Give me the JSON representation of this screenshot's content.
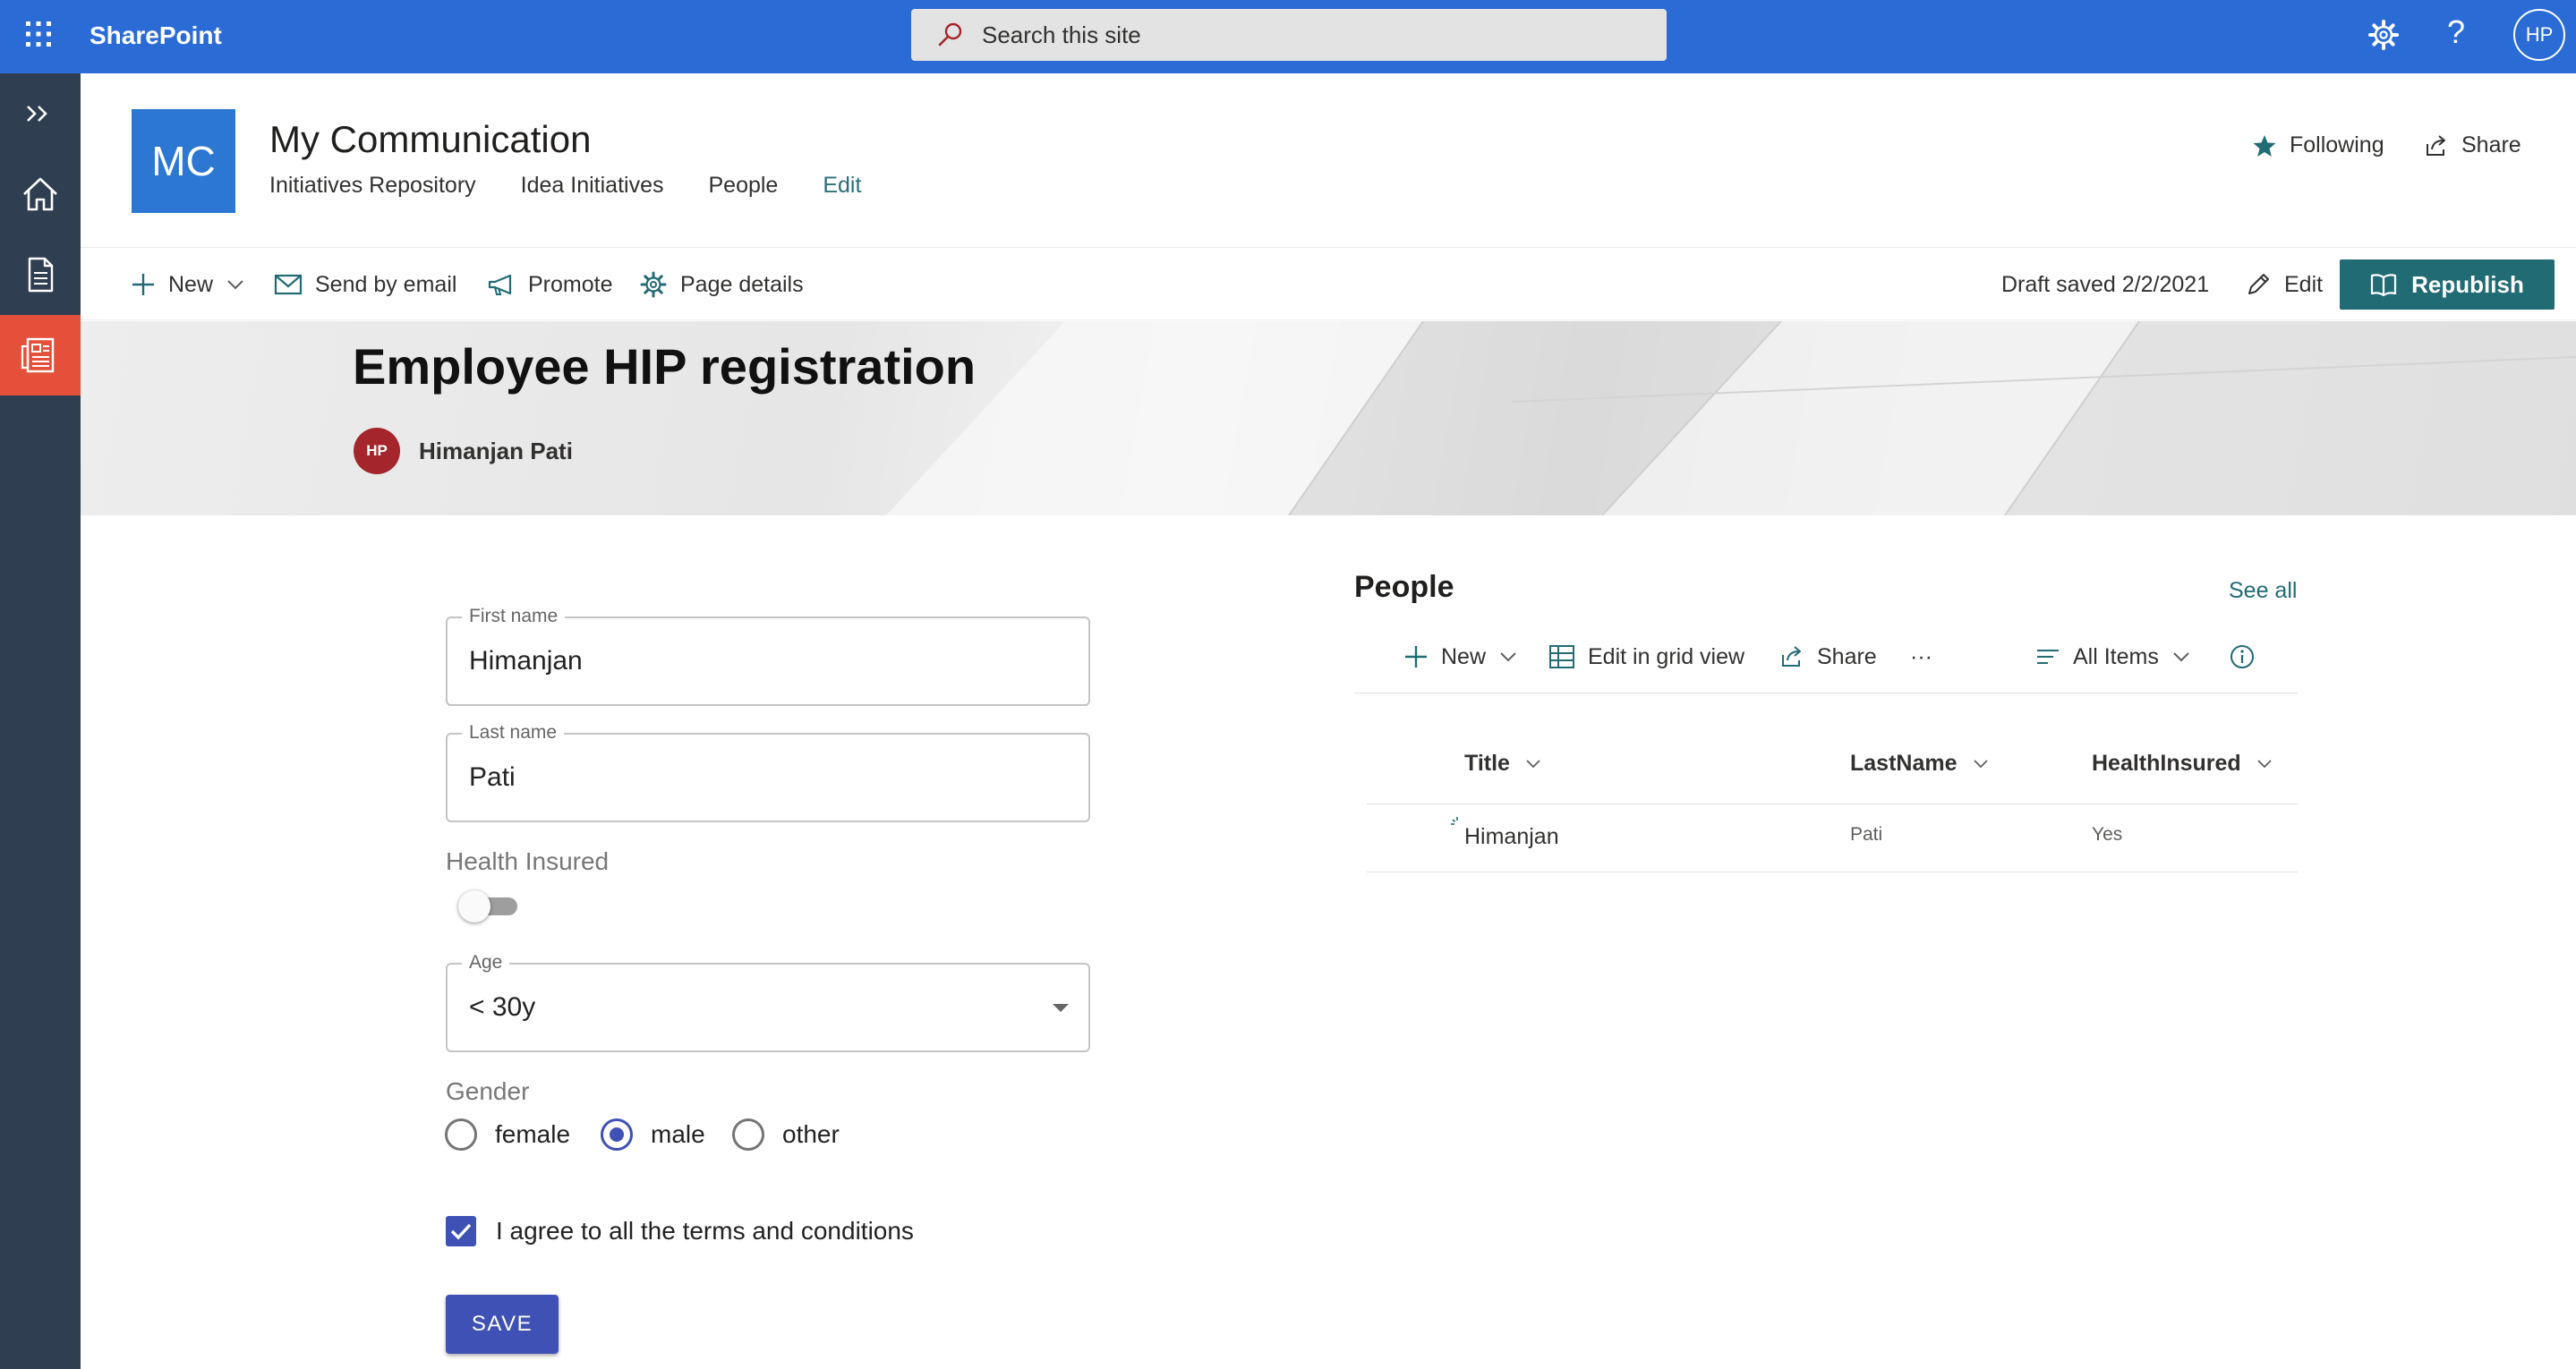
{
  "suite_bar": {
    "app_name": "SharePoint",
    "search_placeholder": "Search this site",
    "help_glyph": "?",
    "user_initials": "HP",
    "icons": [
      "waffle-icon",
      "search-icon",
      "settings-gear-icon",
      "help-icon"
    ]
  },
  "app_bar": {
    "items": [
      "expand-icon",
      "home-icon",
      "page-icon",
      "news-icon"
    ],
    "active_color": "#e5503a"
  },
  "site": {
    "logo_text": "MC",
    "title": "My Communication",
    "nav": [
      "Initiatives Repository",
      "Idea Initiatives",
      "People",
      "Edit"
    ],
    "following_label": "Following",
    "share_label": "Share"
  },
  "command_bar": {
    "new_label": "New",
    "send_email_label": "Send by email",
    "promote_label": "Promote",
    "page_details_label": "Page details",
    "draft_status": "Draft saved 2/2/2021",
    "edit_label": "Edit",
    "republish_label": "Republish"
  },
  "page": {
    "title": "Employee HIP registration",
    "author_initials": "HP",
    "author_name": "Himanjan Pati"
  },
  "form": {
    "first_name": {
      "label": "First name",
      "value": "Himanjan"
    },
    "last_name": {
      "label": "Last name",
      "value": "Pati"
    },
    "health_insured": {
      "label": "Health Insured",
      "checked": false
    },
    "age": {
      "label": "Age",
      "value": "< 30y"
    },
    "gender": {
      "label": "Gender",
      "options": [
        "female",
        "male",
        "other"
      ],
      "selected": "male"
    },
    "terms": {
      "label": "I agree to all the terms and conditions",
      "checked": true
    },
    "save_label": "SAVE"
  },
  "people_list": {
    "title": "People",
    "see_all": "See all",
    "commands": {
      "new": "New",
      "grid": "Edit in grid view",
      "share": "Share",
      "more": "···",
      "view": "All Items"
    },
    "columns": [
      "Title",
      "LastName",
      "HealthInsured"
    ],
    "rows": [
      {
        "title": "Himanjan",
        "last_name": "Pati",
        "health_insured": "Yes"
      }
    ]
  },
  "colors": {
    "suite_bar": "#2b6bd6",
    "app_bar": "#2f3e50",
    "theme_teal": "#216b74",
    "form_primary": "#3f51b5",
    "author_avatar": "#a4262c"
  }
}
